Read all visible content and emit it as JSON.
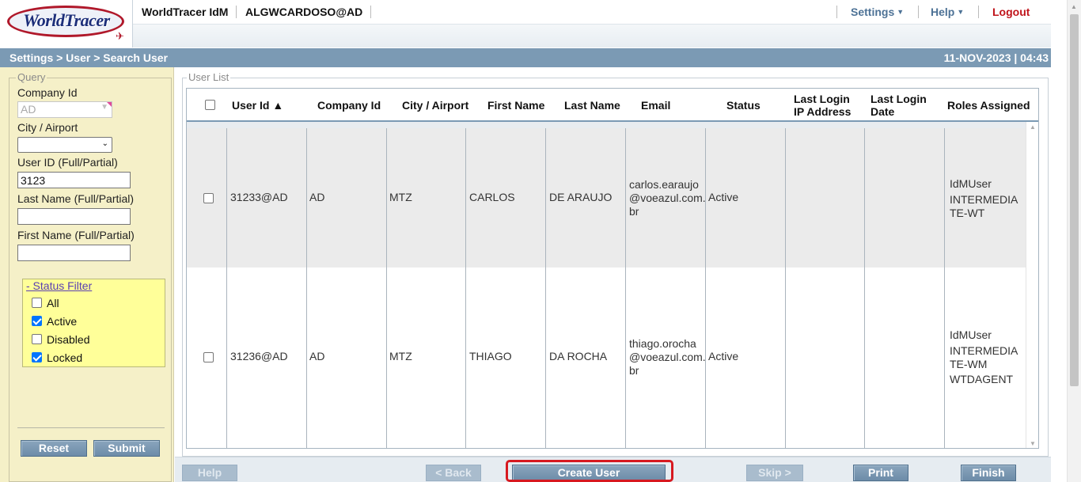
{
  "header": {
    "logo_text": "WorldTracer",
    "app_title": "WorldTracer IdM",
    "user_id": "ALGWCARDOSO@AD",
    "settings_label": "Settings",
    "help_label": "Help",
    "logout_label": "Logout"
  },
  "titlebar": {
    "breadcrumb": "Settings > User > Search User",
    "datetime": "11-NOV-2023 | 04:43"
  },
  "query": {
    "legend": "Query",
    "company_label": "Company Id",
    "company_value": "AD",
    "city_label": "City / Airport",
    "city_value": "",
    "userid_label": "User ID (Full/Partial)",
    "userid_value": "3123",
    "lastname_label": "Last Name (Full/Partial)",
    "lastname_value": "",
    "firstname_label": "First Name (Full/Partial)",
    "firstname_value": "",
    "status_filter": {
      "title": "- Status Filter",
      "options": [
        {
          "label": "All",
          "checked": false
        },
        {
          "label": "Active",
          "checked": true
        },
        {
          "label": "Disabled",
          "checked": false
        },
        {
          "label": "Locked",
          "checked": true
        }
      ]
    },
    "reset_label": "Reset",
    "submit_label": "Submit"
  },
  "user_list": {
    "legend": "User List",
    "columns": [
      {
        "key": "user_id",
        "label": "User Id ▲"
      },
      {
        "key": "company_id",
        "label": "Company Id"
      },
      {
        "key": "city",
        "label": "City / Airport"
      },
      {
        "key": "first_name",
        "label": "First Name"
      },
      {
        "key": "last_name",
        "label": "Last Name"
      },
      {
        "key": "email",
        "label": "Email"
      },
      {
        "key": "status",
        "label": "Status"
      },
      {
        "key": "last_login_ip",
        "label": "Last Login\nIP Address"
      },
      {
        "key": "last_login_date",
        "label": "Last Login\nDate"
      },
      {
        "key": "roles",
        "label": "Roles Assigned"
      }
    ],
    "rows": [
      {
        "user_id": "31233@AD",
        "company_id": "AD",
        "city": "MTZ",
        "first_name": "CARLOS",
        "last_name": "DE ARAUJO",
        "email": "carlos.earaujo\n@voeazul.com.\nbr",
        "status": "Active",
        "last_login_ip": "",
        "last_login_date": "",
        "roles": [
          "IdMUser",
          "INTERMEDIA\nTE-WT"
        ]
      },
      {
        "user_id": "31236@AD",
        "company_id": "AD",
        "city": "MTZ",
        "first_name": "THIAGO",
        "last_name": "DA ROCHA",
        "email": "thiago.orocha\n@voeazul.com.\nbr",
        "status": "Active",
        "last_login_ip": "",
        "last_login_date": "",
        "roles": [
          "IdMUser",
          "INTERMEDIA\nTE-WM",
          "WTDAGENT"
        ]
      }
    ]
  },
  "footer_buttons": {
    "help": "Help",
    "back": "< Back",
    "create_user": "Create User",
    "skip": "Skip >",
    "print": "Print",
    "finish": "Finish"
  }
}
